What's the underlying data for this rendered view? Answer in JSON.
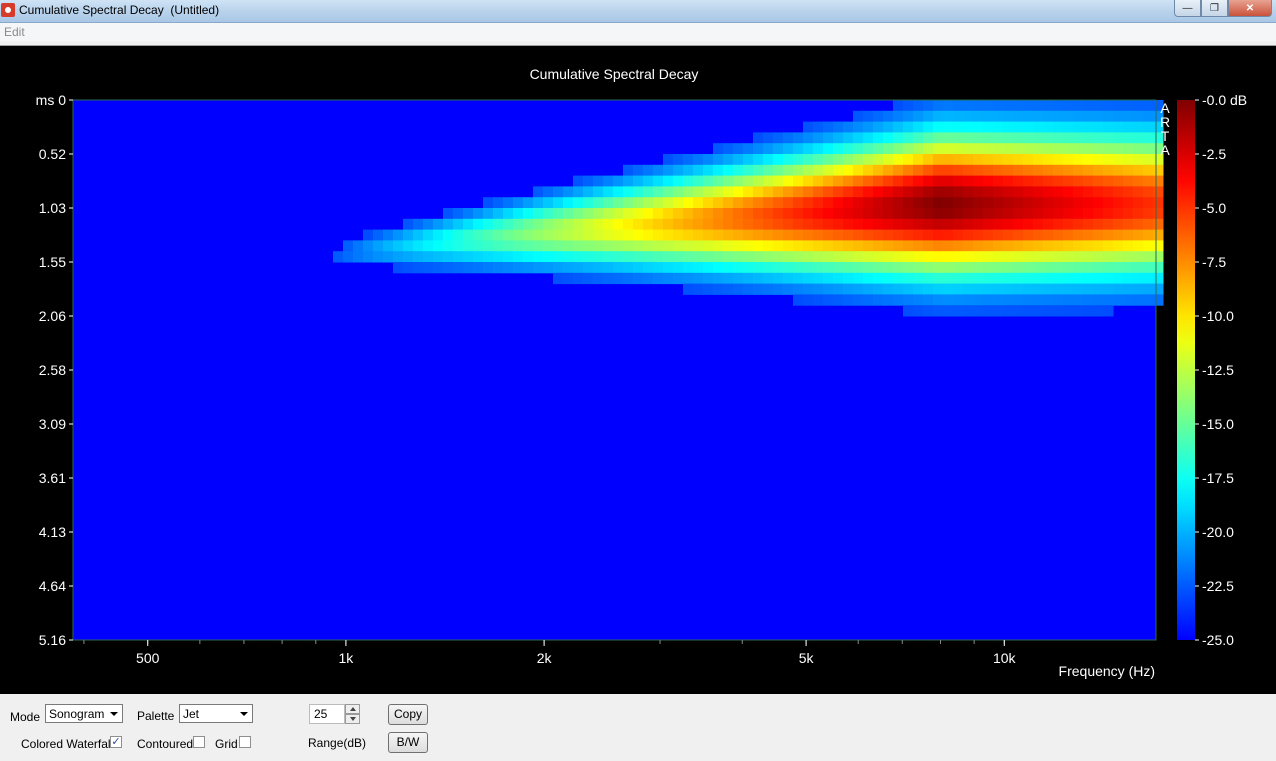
{
  "window": {
    "title": "Cumulative Spectral Decay  (Untitled)",
    "minimize_glyph": "—",
    "maximize_glyph": "❐",
    "close_glyph": "✕"
  },
  "menu": {
    "edit": "Edit"
  },
  "chart_data": {
    "type": "heatmap",
    "title": "Cumulative Spectral Decay",
    "xlabel": "Frequency (Hz)",
    "ylabel": "ms",
    "x_scale": "log",
    "xlim": [
      385,
      17000
    ],
    "x_ticks": [
      {
        "value": 500,
        "label": "500"
      },
      {
        "value": 1000,
        "label": "1k"
      },
      {
        "value": 2000,
        "label": "2k"
      },
      {
        "value": 5000,
        "label": "5k"
      },
      {
        "value": 10000,
        "label": "10k"
      }
    ],
    "ylim": [
      0,
      5.16
    ],
    "y_ticks": [
      "0",
      "0.52",
      "1.03",
      "1.55",
      "2.06",
      "2.58",
      "3.09",
      "3.61",
      "4.13",
      "4.64",
      "5.16"
    ],
    "colorbar": {
      "min": -25.0,
      "max": 0.0,
      "palette": "jet",
      "ticks": [
        "-0.0 dB",
        "-2.5",
        "-5.0",
        "-7.5",
        "-10.0",
        "-12.5",
        "-15.0",
        "-17.5",
        "-20.0",
        "-22.5",
        "-25.0"
      ]
    },
    "watermark": "ARTA",
    "background_level_db": -25.0,
    "peak": {
      "frequency_hz": 8000,
      "time_ms": 1.0,
      "level_db": 0.0
    },
    "decay_onset_frequency_hz": 850,
    "max_decay_time_ms": 2.1,
    "grid": false
  },
  "controls": {
    "mode_label": "Mode",
    "mode_value": "Sonogram",
    "palette_label": "Palette",
    "palette_value": "Jet",
    "range_value": "25",
    "range_label": "Range(dB)",
    "copy_label": "Copy",
    "bw_label": "B/W",
    "colored_waterfall_label": "Colored Waterfall",
    "colored_waterfall_checked": "✓",
    "contoured_label": "Contoured",
    "grid_label": "Grid"
  }
}
